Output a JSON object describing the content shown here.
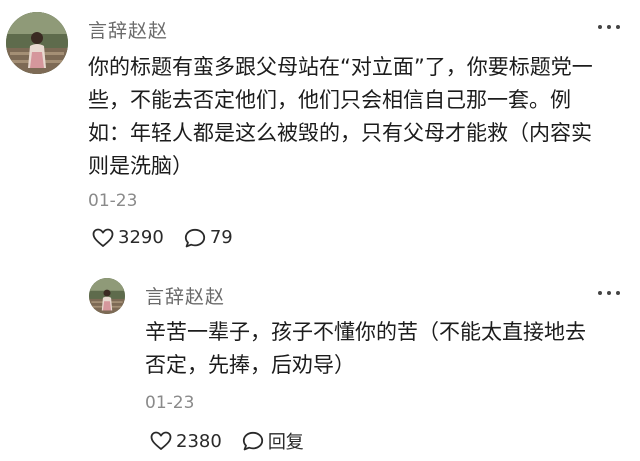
{
  "comment": {
    "username": "言辞赵赵",
    "content_lines": [
      "你的标题有蛮多跟父母站在“对立面”了，你要标题党一",
      "些，不能去否定他们，他们只会相信自己那一套。例",
      "如：年轻人都是这么被毁的，只有父母才能救（内容实",
      "则是洗脑）"
    ],
    "date": "01-23",
    "likes": "3290",
    "replies": "79"
  },
  "reply": {
    "username": "言辞赵赵",
    "content_lines": [
      "辛苦一辈子，孩子不懂你的苦（不能太直接地去",
      "否定，先捧，后劝导）"
    ],
    "date": "01-23",
    "likes": "2380",
    "reply_label": "回复"
  },
  "icons": {
    "more": "more-dots-icon",
    "like": "heart-outline-icon",
    "comment": "speech-bubble-icon"
  },
  "colors": {
    "username": "#6b6b6b",
    "text": "#1c1c1c",
    "meta": "#8a8a8a"
  }
}
